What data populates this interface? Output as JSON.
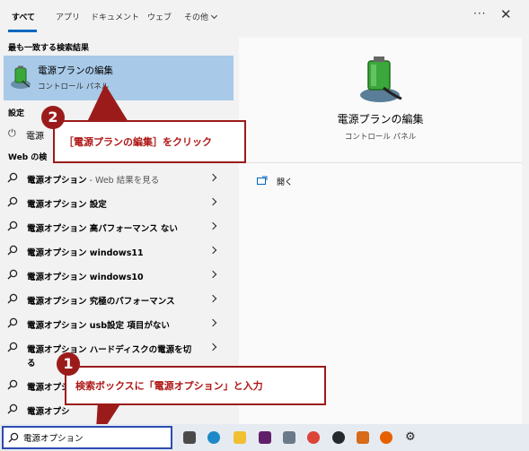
{
  "tabs": {
    "items": [
      {
        "label": "すべて",
        "active": true
      },
      {
        "label": "アプリ"
      },
      {
        "label": "ドキュメント"
      },
      {
        "label": "ウェブ"
      },
      {
        "label": "その他"
      }
    ],
    "more_label": "···",
    "close_label": "✕"
  },
  "left": {
    "best_match_heading": "最も一致する検索結果",
    "best_match": {
      "title": "電源プランの編集",
      "subtitle": "コントロール パネル"
    },
    "settings_heading": "設定",
    "settings_item": "電源",
    "web_heading": "Web の検",
    "web_results": [
      {
        "bold": "電源オプション",
        "suffix": " - Web 結果を見る",
        "suffix_grey": true
      },
      {
        "bold": "電源オプション 設定",
        "suffix": ""
      },
      {
        "bold": "電源オプション 高パフォーマンス ない",
        "suffix": ""
      },
      {
        "bold": "電源オプション windows11",
        "suffix": ""
      },
      {
        "bold": "電源オプション windows10",
        "suffix": ""
      },
      {
        "bold": "電源オプション 究極のパフォーマンス",
        "suffix": ""
      },
      {
        "bold": "電源オプション usb設定 項目がない",
        "suffix": ""
      },
      {
        "bold": "電源オプション ハードディスクの電源を切",
        "line2": "る",
        "suffix": ""
      },
      {
        "bold": "電源オプシ",
        "suffix": ""
      },
      {
        "bold": "電源オプシ",
        "suffix": ""
      }
    ]
  },
  "right": {
    "title": "電源プランの編集",
    "subtitle": "コントロール パネル",
    "open_label": "開く"
  },
  "callouts": {
    "step2": {
      "number": "2",
      "text": "［電源プランの編集］をクリック"
    },
    "step1": {
      "number": "1",
      "text": "検索ボックスに「電源オプション」と入力"
    }
  },
  "taskbar": {
    "search_value": "電源オプション",
    "icons": [
      "calculator-icon",
      "edge-icon",
      "file-explorer-icon",
      "slack-icon",
      "photos-icon",
      "chrome-icon",
      "github-icon",
      "app-icon",
      "firefox-icon",
      "settings-icon"
    ]
  },
  "colors": {
    "accent": "#0067c0",
    "selection": "#a8cae8",
    "callout_red": "#9b1b1b"
  }
}
